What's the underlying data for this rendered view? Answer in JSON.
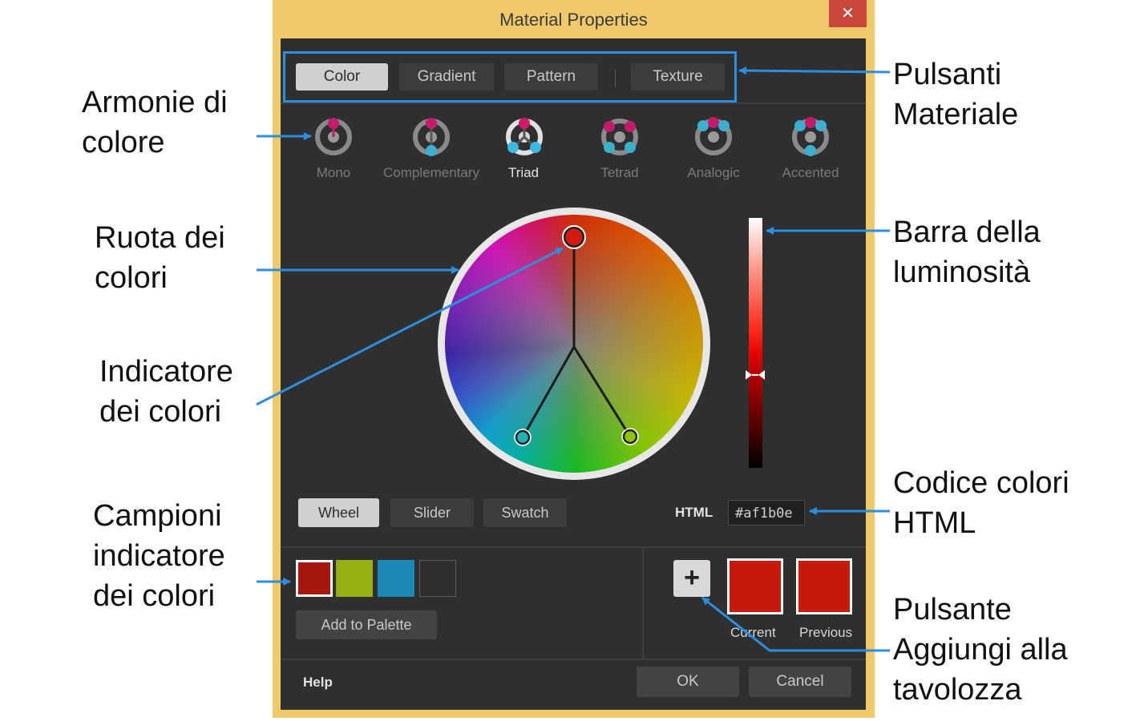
{
  "window": {
    "title": "Material Properties",
    "close_glyph": "✕"
  },
  "material_tabs": [
    {
      "label": "Color",
      "active": true
    },
    {
      "label": "Gradient",
      "active": false
    },
    {
      "label": "Pattern",
      "active": false
    },
    {
      "label": "Texture",
      "active": false
    }
  ],
  "harmonies": [
    {
      "label": "Mono",
      "active": false,
      "icon": "mono-harmony-icon"
    },
    {
      "label": "Complementary",
      "active": false,
      "icon": "complementary-harmony-icon"
    },
    {
      "label": "Triad",
      "active": true,
      "icon": "triad-harmony-icon"
    },
    {
      "label": "Tetrad",
      "active": false,
      "icon": "tetrad-harmony-icon"
    },
    {
      "label": "Analogic",
      "active": false,
      "icon": "analogic-harmony-icon"
    },
    {
      "label": "Accented",
      "active": false,
      "icon": "accented-harmony-icon"
    }
  ],
  "view_modes": [
    {
      "label": "Wheel",
      "active": true
    },
    {
      "label": "Slider",
      "active": false
    },
    {
      "label": "Swatch",
      "active": false
    }
  ],
  "html_code": {
    "label": "HTML",
    "value": "#af1b0e"
  },
  "swatches": [
    {
      "color": "#a8170e",
      "selected": true
    },
    {
      "color": "#95b012",
      "selected": false
    },
    {
      "color": "#1889b5",
      "selected": false
    },
    {
      "color": "#2f2f2f",
      "selected": false
    }
  ],
  "add_to_palette_label": "Add to Palette",
  "plus_glyph": "+",
  "current": {
    "label": "Current",
    "color": "#c7180c"
  },
  "previous": {
    "label": "Previous",
    "color": "#c7180c"
  },
  "help_label": "Help",
  "ok_label": "OK",
  "cancel_label": "Cancel",
  "colors": {
    "accent": "#2c8ee0",
    "frame": "#f0c96a",
    "panel": "#2f2f2f"
  },
  "annotations": {
    "pulsanti_materiale": [
      "Pulsanti",
      "Materiale"
    ],
    "armonie": [
      "Armonie di",
      "colore"
    ],
    "ruota": [
      "Ruota dei",
      "colori"
    ],
    "barra": [
      "Barra della",
      "luminosità"
    ],
    "indicatore": [
      "Indicatore",
      "dei colori"
    ],
    "codice": [
      "Codice colori",
      "HTML"
    ],
    "campioni": [
      "Campioni",
      "indicatore",
      "dei colori"
    ],
    "pulsante_aggiungi": [
      "Pulsante",
      "Aggiungi alla",
      "tavolozza"
    ]
  }
}
